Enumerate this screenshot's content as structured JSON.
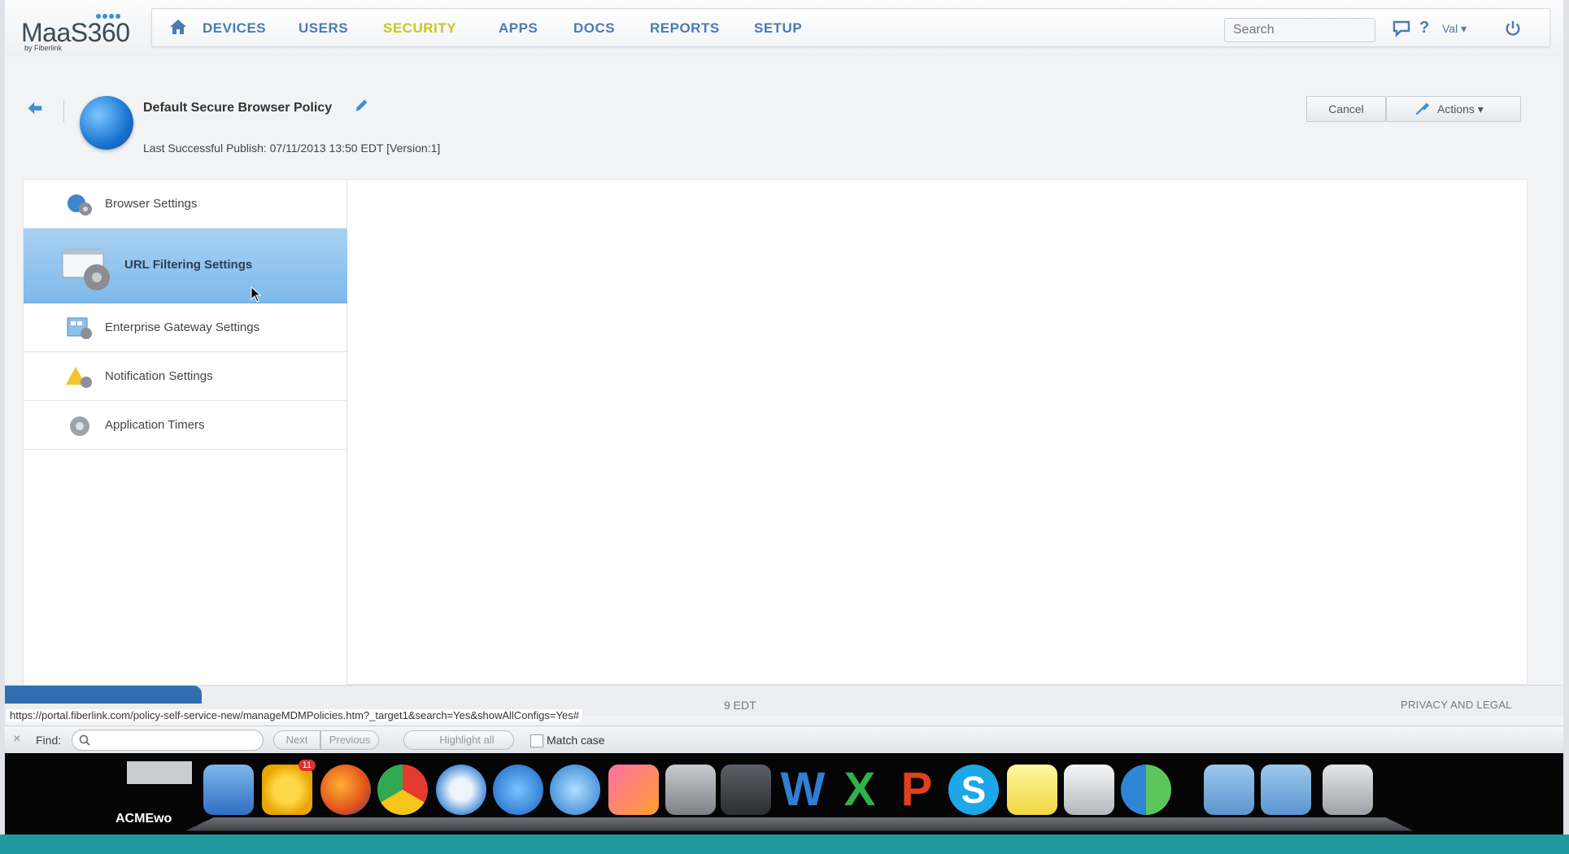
{
  "brand": {
    "logo_text": "MaaS360",
    "logo_sub": "by Fiberlink"
  },
  "nav": {
    "items": [
      "DEVICES",
      "USERS",
      "SECURITY",
      "APPS",
      "DOCS",
      "REPORTS",
      "SETUP"
    ],
    "active": "SECURITY",
    "search_placeholder": "Search",
    "help_label": "?",
    "user_label": "Val ▾"
  },
  "policy": {
    "title": "Default Secure Browser Policy",
    "publish_info": "Last Successful Publish: 07/11/2013 13:50 EDT  [Version:1]",
    "cancel_label": "Cancel",
    "actions_label": "Actions ▾"
  },
  "sidebar": {
    "items": [
      {
        "label": "Browser Settings",
        "icon": "browser-settings-icon"
      },
      {
        "label": "URL Filtering Settings",
        "icon": "url-filtering-icon",
        "active": true
      },
      {
        "label": "Enterprise Gateway Settings",
        "icon": "enterprise-gateway-icon"
      },
      {
        "label": "Notification Settings",
        "icon": "notification-icon"
      },
      {
        "label": "Application Timers",
        "icon": "timer-gear-icon"
      }
    ]
  },
  "status": {
    "edt_fragment": "9 EDT",
    "privacy_label": "PRIVACY AND LEGAL",
    "url": "https://portal.fiberlink.com/policy-self-service-new/manageMDMPolicies.htm?_target1&search=Yes&showAllConfigs=Yes#"
  },
  "findbar": {
    "close": "×",
    "label": "Find:",
    "next_label": "Next",
    "previous_label": "Previous",
    "highlight_label": "Highlight all",
    "match_case_label": "Match case"
  },
  "dock": {
    "label": "ACMEwo",
    "icons": [
      "finder-icon",
      "outlook-icon",
      "firefox-icon",
      "chrome-icon",
      "safari-icon",
      "app-store-icon",
      "itunes-icon",
      "photo-booth-icon",
      "system-preferences-icon",
      "facetime-icon",
      "word-icon",
      "excel-icon",
      "powerpoint-icon",
      "skype-icon",
      "stickies-icon",
      "preview-icon",
      "globe-app-icon",
      "applications-folder-icon",
      "documents-folder-icon",
      "trash-icon"
    ],
    "outlook_badge": "11"
  },
  "colors": {
    "nav_text": "#4a7bb4",
    "nav_active": "#c6c81a",
    "sidebar_active": "#8cc2ee",
    "dock_bg": "#050506"
  }
}
